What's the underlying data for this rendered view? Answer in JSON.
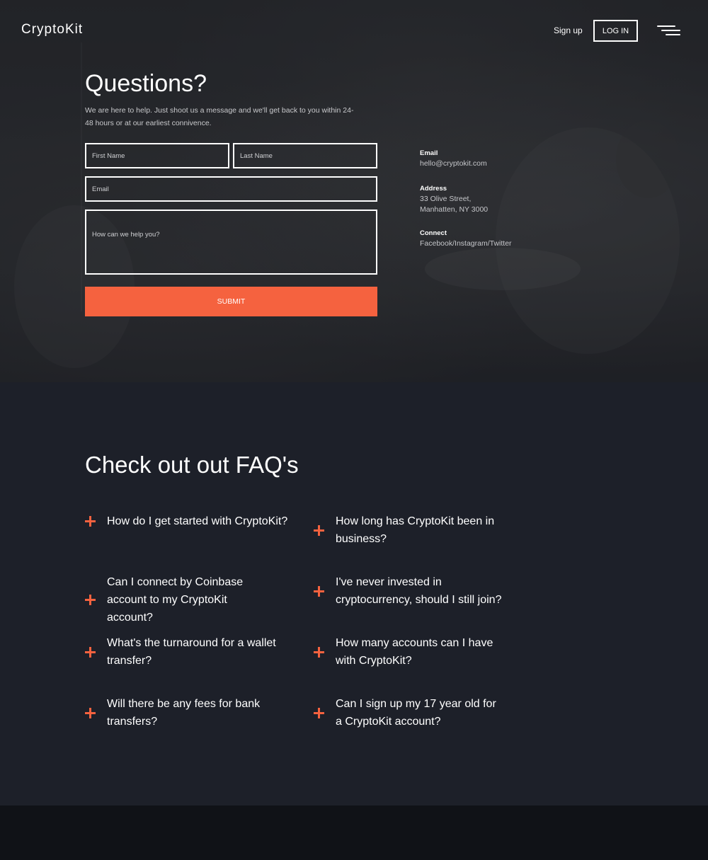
{
  "nav": {
    "logo": "CryptoKit",
    "signup": "Sign up",
    "login": "LOG IN",
    "menu_icon": "hamburger-menu-icon"
  },
  "contact": {
    "title": "Questions?",
    "subtitle": "We are here to help. Just shoot us a message and we'll get back to you within 24-48 hours or at our earliest connivence.",
    "first_name_placeholder": "First Name",
    "last_name_placeholder": "Last Name",
    "email_placeholder": "Email",
    "message_placeholder": "How can we help you?",
    "submit_label": "SUBMIT",
    "info": {
      "email_label": "Email",
      "email_value": "hello@cryptokit.com",
      "address_label": "Address",
      "address_line1": "33 Olive Street,",
      "address_line2": "Manhatten, NY 3000",
      "connect_label": "Connect",
      "connect_value": "Facebook/Instagram/Twitter"
    }
  },
  "faq": {
    "title": "Check out out FAQ's",
    "items": [
      {
        "question": "How do I get started with CryptoKit?"
      },
      {
        "question": "How long has CryptoKit been in business?"
      },
      {
        "question": "Can I connect by Coinbase account to my CryptoKit account?"
      },
      {
        "question": "I've never invested in cryptocurrency, should I still join?"
      },
      {
        "question": "What's the turnaround for a wallet transfer?"
      },
      {
        "question": "How many accounts can I have with CryptoKit?"
      },
      {
        "question": "Will there be any fees for bank transfers?"
      },
      {
        "question": "Can I sign up my 17 year old for a CryptoKit account?"
      }
    ]
  },
  "colors": {
    "accent": "#f5623f",
    "background": "#1d2029",
    "footer": "#101217"
  }
}
